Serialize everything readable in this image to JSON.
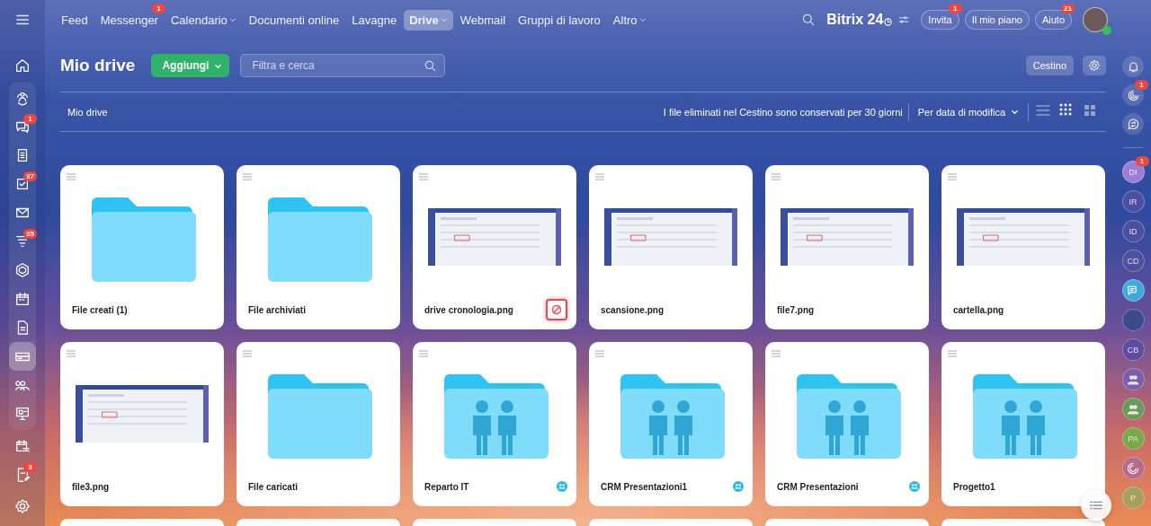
{
  "top_nav": [
    {
      "label": "Feed",
      "selected": false,
      "dropdown": false
    },
    {
      "label": "Messenger",
      "selected": false,
      "badge": "1",
      "dropdown": false
    },
    {
      "label": "Calendario",
      "selected": false,
      "dropdown": true
    },
    {
      "label": "Documenti online",
      "selected": false,
      "dropdown": false
    },
    {
      "label": "Lavagne",
      "selected": false,
      "dropdown": false
    },
    {
      "label": "Drive",
      "selected": true,
      "dropdown": true
    },
    {
      "label": "Webmail",
      "selected": false,
      "dropdown": false
    },
    {
      "label": "Gruppi di lavoro",
      "selected": false,
      "dropdown": false
    },
    {
      "label": "Altro",
      "selected": false,
      "dropdown": true
    }
  ],
  "logo": {
    "name": "Bitrix",
    "number": "24"
  },
  "header_buttons": [
    {
      "label": "Invita",
      "badge": "1"
    },
    {
      "label": "Il mio piano"
    },
    {
      "label": "Aiuto",
      "badge": "21"
    }
  ],
  "left_sidebar": [
    {
      "selected": false
    },
    {
      "badge": "1",
      "selected": false
    },
    {
      "selected": false
    },
    {
      "badge": "37",
      "selected": false
    },
    {
      "selected": false
    },
    {
      "badge": "35",
      "selected": false
    },
    {
      "selected": false
    },
    {
      "selected": false
    },
    {
      "selected": false
    },
    {
      "selected": true
    },
    {
      "selected": false
    },
    {
      "selected": false
    },
    {
      "selected": false
    },
    {
      "badge": "3",
      "selected": false
    }
  ],
  "right_tools": [
    {
      "kind": "bell"
    },
    {
      "kind": "swirl",
      "badge": "1"
    },
    {
      "kind": "chat"
    }
  ],
  "contacts": [
    {
      "kind": "initials",
      "text": "DI",
      "color": "#9b7fd6",
      "badge": "1"
    },
    {
      "kind": "initials",
      "text": "IR",
      "color": "#4a4fa3"
    },
    {
      "kind": "initials",
      "text": "ID",
      "color": "#4a4fa3"
    },
    {
      "kind": "initials",
      "text": "CD",
      "color": "#4f4fa0"
    },
    {
      "kind": "chat",
      "color": "#3fa9dc"
    },
    {
      "kind": "photo",
      "color": "#3b4a8a"
    },
    {
      "kind": "initials",
      "text": "CB",
      "color": "#5e4c9e"
    },
    {
      "kind": "group",
      "color": "#7a5fa8"
    },
    {
      "kind": "group",
      "color": "#6a9a5a"
    },
    {
      "kind": "initials",
      "text": "PA",
      "color": "#7aa84a"
    },
    {
      "kind": "swirl",
      "color": "#b86a8a"
    },
    {
      "kind": "initials",
      "text": "P",
      "color": "#a5a060"
    }
  ],
  "page": {
    "title": "Mio drive",
    "add_button": "Aggiungi",
    "search": {
      "placeholder": "Filtra e cerca"
    },
    "trash_button": "Cestino"
  },
  "toolbar": {
    "breadcrumb": "Mio drive",
    "notice": "I file eliminati nel Cestino sono conservati per 30 giorni",
    "sort": "Per data di modifica",
    "views": [
      {
        "selected": false
      },
      {
        "selected": true
      },
      {
        "selected": false
      }
    ]
  },
  "files": [
    {
      "kind": "folder",
      "name": "File creati (1)",
      "shared": false,
      "blocked": false
    },
    {
      "kind": "folder",
      "name": "File archiviati",
      "shared": false,
      "blocked": false
    },
    {
      "kind": "image",
      "name": "drive cronologia.png",
      "shared": false,
      "blocked": true
    },
    {
      "kind": "image",
      "name": "scansione.png",
      "shared": false,
      "blocked": false
    },
    {
      "kind": "image",
      "name": "file7.png",
      "shared": false,
      "blocked": false
    },
    {
      "kind": "image",
      "name": "cartella.png",
      "shared": false,
      "blocked": false
    },
    {
      "kind": "image",
      "name": "file3.png",
      "shared": false,
      "blocked": false
    },
    {
      "kind": "folder",
      "name": "File caricati",
      "shared": false,
      "blocked": false
    },
    {
      "kind": "group_folder",
      "name": "Reparto IT",
      "shared": true,
      "blocked": false
    },
    {
      "kind": "group_folder",
      "name": "CRM Presentazioni1",
      "shared": true,
      "blocked": false
    },
    {
      "kind": "group_folder",
      "name": "CRM Presentazioni",
      "shared": true,
      "blocked": false
    },
    {
      "kind": "group_folder",
      "name": "Progetto1",
      "shared": false,
      "blocked": false
    }
  ]
}
